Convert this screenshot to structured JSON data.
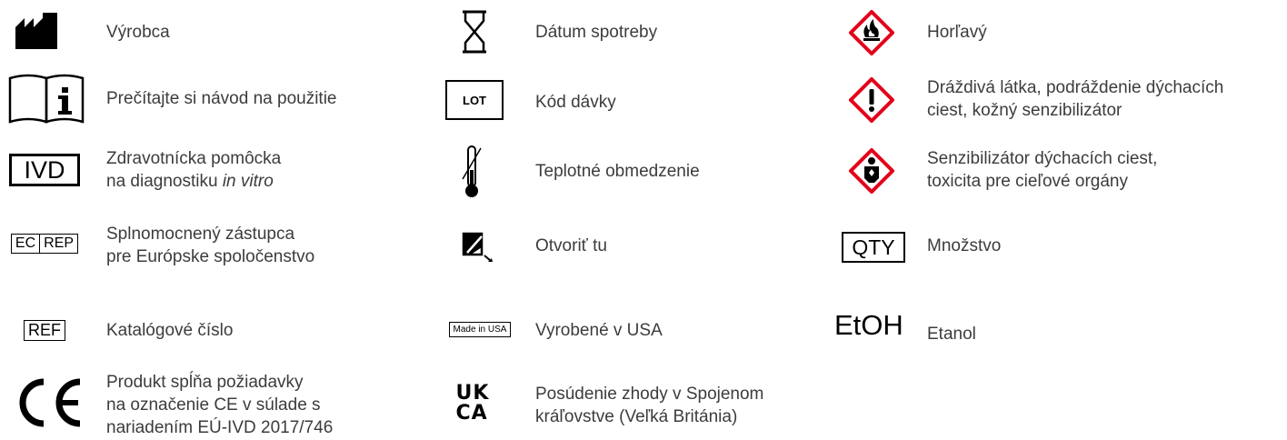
{
  "items": [
    {
      "symbol": "manufacturer-icon",
      "lines": [
        "Výrobca"
      ]
    },
    {
      "symbol": "instructions-icon",
      "lines": [
        "Prečítajte si návod na použitie"
      ]
    },
    {
      "symbol": "ivd-icon",
      "symbol_text": "IVD",
      "lines": [
        "Zdravotnícka pomôcka",
        "na diagnostiku "
      ],
      "italic": "in vitro"
    },
    {
      "symbol": "ec-rep-icon",
      "symbol_text_a": "EC",
      "symbol_text_b": "REP",
      "lines": [
        "Splnomocnený zástupca",
        "pre Európske spoločenstvo"
      ]
    },
    {
      "symbol": "ref-icon",
      "symbol_text": "REF",
      "lines": [
        "Katalógové číslo"
      ]
    },
    {
      "symbol": "ce-mark-icon",
      "lines": [
        "Produkt spĺňa požiadavky",
        "na označenie CE v súlade s",
        "nariadením EÚ-IVD 2017/746"
      ]
    },
    {
      "symbol": "hourglass-icon",
      "lines": [
        "Dátum spotreby"
      ]
    },
    {
      "symbol": "lot-icon",
      "symbol_text": "LOT",
      "lines": [
        "Kód dávky"
      ]
    },
    {
      "symbol": "thermometer-icon",
      "lines": [
        "Teplotné obmedzenie"
      ]
    },
    {
      "symbol": "open-here-icon",
      "lines": [
        "Otvoriť tu"
      ]
    },
    {
      "symbol": "made-in-usa-icon",
      "symbol_text": "Made in USA",
      "lines": [
        "Vyrobené v USA"
      ]
    },
    {
      "symbol": "ukca-icon",
      "symbol_text_a": "UK",
      "symbol_text_b": "CA",
      "lines": [
        "Posúdenie zhody v Spojenom",
        "kráľovstve (Veľká Británia)"
      ]
    },
    {
      "symbol": "flammable-icon",
      "lines": [
        "Horľavý"
      ]
    },
    {
      "symbol": "irritant-icon",
      "lines": [
        "Dráždivá látka, podráždenie dýchacích",
        "ciest, kožný senzibilizátor"
      ]
    },
    {
      "symbol": "health-hazard-icon",
      "lines": [
        "Senzibilizátor dýchacích ciest,",
        "toxicita pre cieľové orgány"
      ]
    },
    {
      "symbol": "qty-icon",
      "symbol_text": "QTY",
      "lines": [
        "Množstvo"
      ]
    },
    {
      "symbol": "etoh-icon",
      "symbol_text": "EtOH",
      "lines": [
        "Etanol"
      ]
    }
  ],
  "colors": {
    "text": "#3c3c3c",
    "symbol": "#000000",
    "hazard_red": "#e3001b"
  }
}
